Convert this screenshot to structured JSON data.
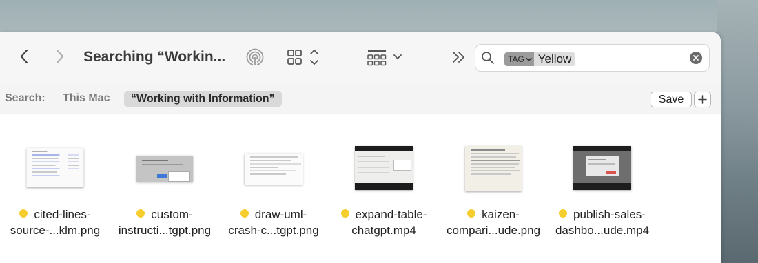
{
  "toolbar": {
    "title": "Searching “Workin...",
    "back_icon": "chevron-left-icon",
    "forward_icon": "chevron-right-icon"
  },
  "search": {
    "tag_label": "TAG",
    "tag_value": "Yellow"
  },
  "scope": {
    "label": "Search:",
    "this_mac": "This Mac",
    "folder": "“Working with Information”",
    "save_label": "Save"
  },
  "files": [
    {
      "line1": "cited-lines-",
      "line2": "source-...klm.png",
      "tag_color": "#f5cd2d"
    },
    {
      "line1": "custom-",
      "line2": "instructi...tgpt.png",
      "tag_color": "#f5cd2d"
    },
    {
      "line1": "draw-uml-",
      "line2": "crash-c...tgpt.png",
      "tag_color": "#f5cd2d"
    },
    {
      "line1": "expand-table-",
      "line2": "chatgpt.mp4",
      "tag_color": "#f5cd2d"
    },
    {
      "line1": "kaizen-",
      "line2": "compari...ude.png",
      "tag_color": "#f5cd2d"
    },
    {
      "line1": "publish-sales-",
      "line2": "dashbo...ude.mp4",
      "tag_color": "#f5cd2d"
    }
  ],
  "colors": {
    "tag_yellow": "#f5cd2d",
    "window_bg": "#ffffff",
    "toolbar_bg": "#f6f6f6"
  }
}
